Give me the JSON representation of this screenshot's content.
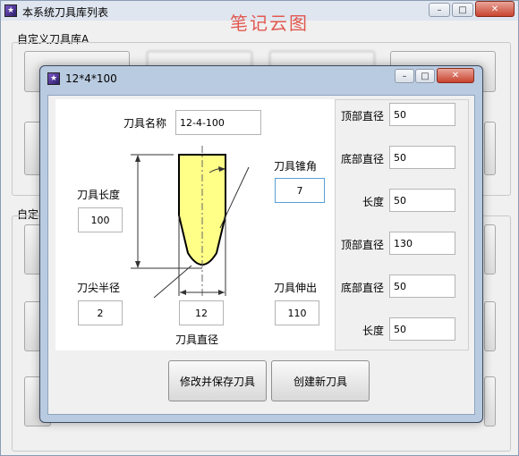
{
  "main_window": {
    "title": "本系统刀具库列表",
    "group_a_label": "自定义刀具库A",
    "group_b_label": "自定"
  },
  "watermark": "笔记云图",
  "dialog": {
    "title": "12*4*100",
    "tool_name_label": "刀具名称",
    "tool_name_value": "12-4-100",
    "taper_angle_label": "刀具锥角",
    "taper_angle_value": "7",
    "tool_length_label": "刀具长度",
    "tool_length_value": "100",
    "tip_radius_label": "刀尖半径",
    "tip_radius_value": "2",
    "diameter_value": "12",
    "diameter_label": "刀具直径",
    "extension_label": "刀具伸出",
    "extension_value": "110",
    "right_fields": [
      {
        "label": "顶部直径",
        "value": "50"
      },
      {
        "label": "底部直径",
        "value": "50"
      },
      {
        "label": "长度",
        "value": "50"
      },
      {
        "label": "顶部直径",
        "value": "130"
      },
      {
        "label": "底部直径",
        "value": "50"
      },
      {
        "label": "长度",
        "value": "50"
      }
    ],
    "save_button": "修改并保存刀具",
    "create_button": "创建新刀具"
  },
  "colors": {
    "tool_fill": "#ffff88",
    "accent_red": "#e1584f"
  }
}
